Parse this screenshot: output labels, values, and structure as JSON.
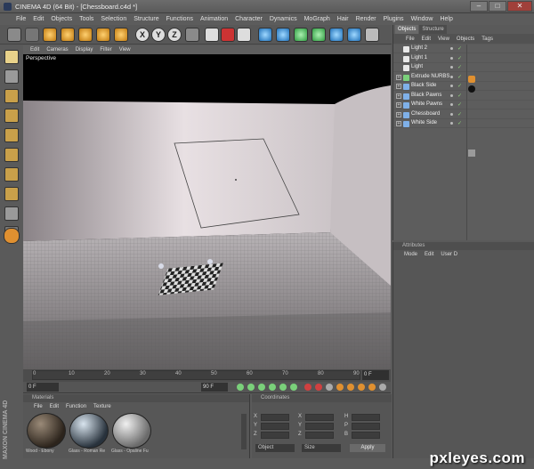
{
  "window": {
    "title": "CINEMA 4D (64 Bit) - [Chessboard.c4d *]"
  },
  "menubar": [
    "File",
    "Edit",
    "Objects",
    "Tools",
    "Selection",
    "Structure",
    "Functions",
    "Animation",
    "Character",
    "Dynamics",
    "MoGraph",
    "Hair",
    "Render",
    "Plugins",
    "Window",
    "Help"
  ],
  "viewport": {
    "menu": [
      "Edit",
      "Cameras",
      "Display",
      "Filter",
      "View"
    ],
    "label": "Perspective"
  },
  "timeline": {
    "ticks": [
      "0",
      "10",
      "20",
      "30",
      "40",
      "50",
      "60",
      "70",
      "80",
      "90"
    ],
    "end_frame": "0 F",
    "start_field": "0 F",
    "end_field": "90 F"
  },
  "materials": {
    "title": "Materials",
    "menu": [
      "File",
      "Edit",
      "Function",
      "Texture"
    ],
    "items": [
      "Wood - Ebony",
      "Glass - Roman Re",
      "Glass - Opaline Fu"
    ]
  },
  "coordinates": {
    "title": "Coordinates",
    "labels": [
      "X",
      "Y",
      "Z"
    ],
    "h_labels": [
      "H",
      "P",
      "B"
    ],
    "mode_options": [
      "Object",
      "Size"
    ],
    "apply_label": "Apply"
  },
  "objects": {
    "tabs": [
      "Objects",
      "Structure"
    ],
    "menu": [
      "File",
      "Edit",
      "View",
      "Objects",
      "Tags"
    ],
    "items": [
      {
        "name": "Light 2",
        "icon_color": "#e8e8e8"
      },
      {
        "name": "Light 1",
        "icon_color": "#e8e8e8"
      },
      {
        "name": "Light",
        "icon_color": "#e8e8e8"
      },
      {
        "name": "Extrude NURBS",
        "icon_color": "#7ad07a"
      },
      {
        "name": "Black Side",
        "icon_color": "#7fb0e8"
      },
      {
        "name": "Black Pawns",
        "icon_color": "#7fb0e8"
      },
      {
        "name": "White Pawns",
        "icon_color": "#7fb0e8"
      },
      {
        "name": "Chessboard",
        "icon_color": "#7fb0e8"
      },
      {
        "name": "White Side",
        "icon_color": "#7fb0e8"
      }
    ]
  },
  "attributes": {
    "title": "Attributes",
    "menu": [
      "Mode",
      "Edit",
      "User D"
    ]
  },
  "sidebar_brand": "MAXON CINEMA 4D",
  "watermark": "pxleyes.com"
}
